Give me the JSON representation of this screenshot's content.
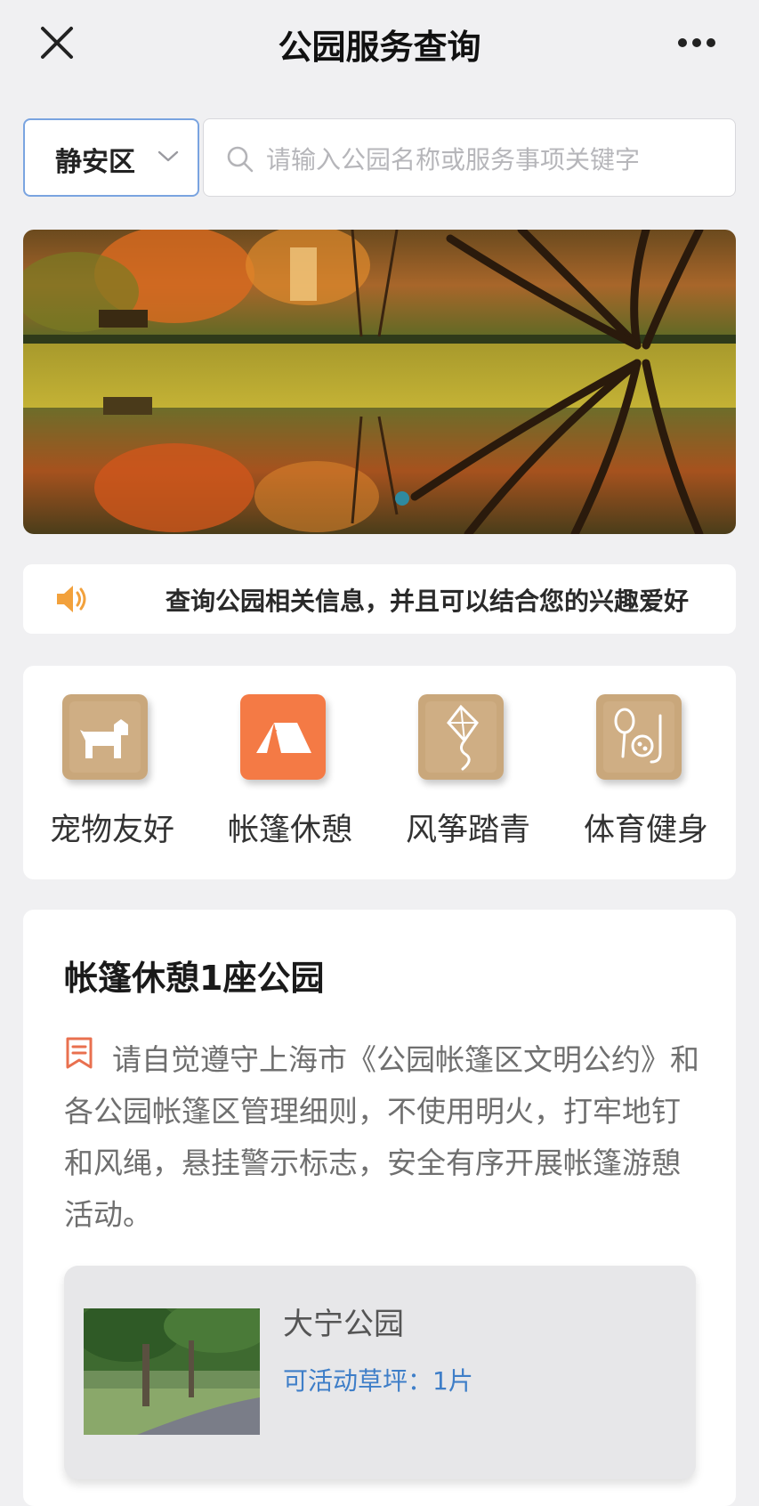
{
  "navbar": {
    "title": "公园服务查询",
    "close_icon": "close-icon",
    "more_icon": "more-icon"
  },
  "search": {
    "district": "静安区",
    "placeholder": "请输入公园名称或服务事项关键字"
  },
  "banner": {
    "slide_count": 1,
    "active_slide": 1
  },
  "notice": {
    "icon": "speaker-icon",
    "text": "查询公园相关信息，并且可以结合您的兴趣爱好"
  },
  "categories": [
    {
      "label": "宠物友好",
      "icon": "dog-icon"
    },
    {
      "label": "帐篷休憩",
      "icon": "tent-icon"
    },
    {
      "label": "风筝踏青",
      "icon": "kite-icon"
    },
    {
      "label": "体育健身",
      "icon": "sports-icon"
    }
  ],
  "result": {
    "title": "帐篷休憩1座公园",
    "rule_icon": "notice-book-icon",
    "rule_text": "请自觉遵守上海市《公园帐篷区文明公约》和各公园帐篷区管理细则，不使用明火，打牢地钉和风绳，悬挂警示标志，安全有序开展帐篷游憩活动。",
    "parks": [
      {
        "name": "大宁公园",
        "lawn": "可活动草坪：1片"
      }
    ]
  },
  "colors": {
    "accent_blue": "#3e7ec8",
    "gold_icon": "#c8a678",
    "orange_icon": "#f47a45",
    "speaker": "#f2a13c",
    "rule_icon": "#e9704f"
  }
}
